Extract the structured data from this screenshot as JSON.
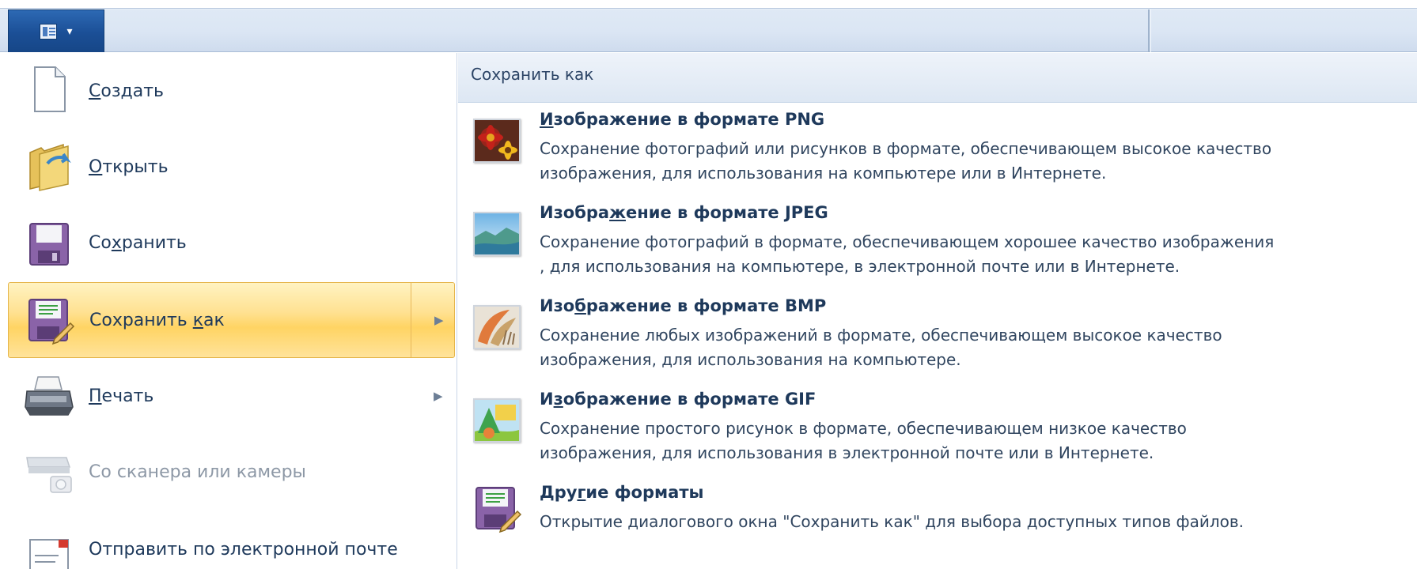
{
  "ribbon": {
    "app_button_caret": "▾"
  },
  "left_menu": {
    "items": [
      {
        "label_pre": "",
        "label_key": "С",
        "label_post": "оздать",
        "icon": "new-document-icon"
      },
      {
        "label_pre": "",
        "label_key": "О",
        "label_post": "ткрыть",
        "icon": "open-folder-icon"
      },
      {
        "label_pre": "Со",
        "label_key": "х",
        "label_post": "ранить",
        "icon": "save-disk-icon"
      },
      {
        "label_pre": "Сохранить ",
        "label_key": "к",
        "label_post": "ак",
        "icon": "save-as-icon",
        "selected": true,
        "has_submenu": true
      },
      {
        "label_pre": "",
        "label_key": "П",
        "label_post": "ечать",
        "icon": "printer-icon",
        "has_submenu": true
      },
      {
        "label_pre": "Со сканера или камеры",
        "label_key": "",
        "label_post": "",
        "icon": "scanner-icon",
        "disabled": true
      },
      {
        "label_pre": "Отправить по электронной почте",
        "label_key": "",
        "label_post": "",
        "icon": "email-icon"
      }
    ],
    "submenu_arrow": "▶"
  },
  "save_as_panel": {
    "title": "Сохранить как",
    "options": [
      {
        "title_pre": "",
        "title_key": "И",
        "title_post": "зображение в формате PNG",
        "desc_line1": "Сохранение фотографий или рисунков в формате, обеспечивающем высокое качество",
        "desc_line2": "изображения, для использования на компьютере или в Интернете.",
        "icon": "png-flower-icon"
      },
      {
        "title_pre": "Изобра",
        "title_key": "ж",
        "title_post": "ение в формате JPEG",
        "desc_line1": "Сохранение фотографий в формате, обеспечивающем хорошее качество изображения",
        "desc_line2": ", для использования на компьютере, в электронной почте или в Интернете.",
        "icon": "jpeg-landscape-icon"
      },
      {
        "title_pre": "Изо",
        "title_key": "б",
        "title_post": "ражение в формате BMP",
        "desc_line1": "Сохранение любых изображений в формате, обеспечивающем высокое качество",
        "desc_line2": "изображения, для использования на компьютере.",
        "icon": "bmp-paint-icon"
      },
      {
        "title_pre": "И",
        "title_key": "з",
        "title_post": "ображение в формате GIF",
        "desc_line1": "Сохранение простого рисунок в формате, обеспечивающем низкое качество",
        "desc_line2": "изображения, для использования в электронной почте или в Интернете.",
        "icon": "gif-shapes-icon"
      },
      {
        "title_pre": "Дру",
        "title_key": "г",
        "title_post": "ие форматы",
        "desc_line1": "Открытие диалогового окна \"Сохранить как\" для выбора доступных типов файлов.",
        "desc_line2": "",
        "icon": "save-as-icon"
      }
    ]
  }
}
